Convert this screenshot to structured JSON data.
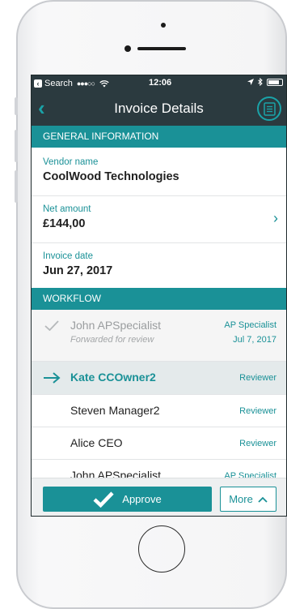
{
  "status_bar": {
    "back_label": "Search",
    "signal": "●●●○○",
    "time": "12:06"
  },
  "nav": {
    "title": "Invoice Details"
  },
  "general": {
    "header": "GENERAL INFORMATION",
    "fields": [
      {
        "label": "Vendor name",
        "value": "CoolWood Technologies"
      },
      {
        "label": "Net amount",
        "value": "£144,00"
      },
      {
        "label": "Invoice date",
        "value": "Jun 27, 2017"
      }
    ]
  },
  "workflow": {
    "header": "WORKFLOW",
    "steps": [
      {
        "name": "John APSpecialist",
        "note": "Forwarded for review",
        "role": "AP Specialist",
        "date": "Jul 7, 2017",
        "state": "completed"
      },
      {
        "name": "Kate CCOwner2",
        "role": "Reviewer",
        "state": "current"
      },
      {
        "name": "Steven Manager2",
        "role": "Reviewer",
        "state": "pending"
      },
      {
        "name": "Alice CEO",
        "role": "Reviewer",
        "state": "pending"
      },
      {
        "name": "John APSpecialist",
        "role": "AP Specialist",
        "state": "pending"
      }
    ]
  },
  "actions": {
    "approve_label": "Approve",
    "more_label": "More"
  },
  "colors": {
    "teal": "#1a9197",
    "header_dark": "#2b3a3f",
    "current_row": "#e4eaeb"
  }
}
